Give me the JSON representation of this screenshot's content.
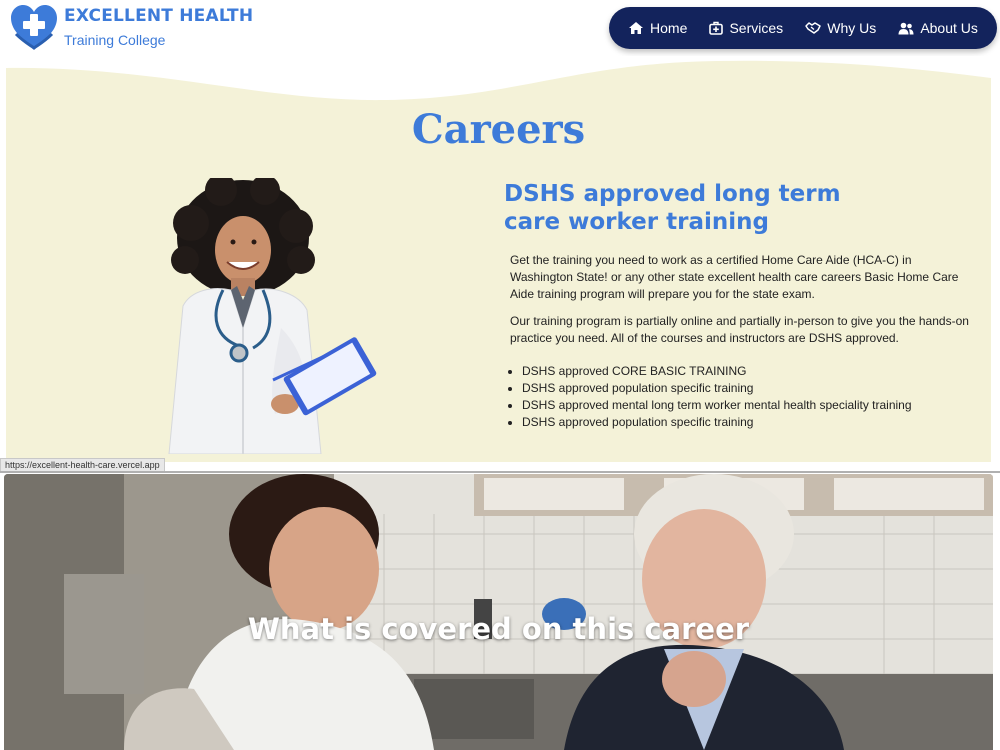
{
  "brand": {
    "title": "EXCELLENT HEALTH",
    "subtitle": "Training College"
  },
  "nav": {
    "items": [
      {
        "label": "Home",
        "icon": "home-icon"
      },
      {
        "label": "Services",
        "icon": "medical-bag-icon"
      },
      {
        "label": "Why Us",
        "icon": "handshake-icon"
      },
      {
        "label": "About Us",
        "icon": "users-icon"
      }
    ]
  },
  "careers": {
    "title": "Careers",
    "headline": "DSHS approved long term care worker training",
    "paragraphs": [
      "Get the training you need to work as a certified Home Care Aide (HCA-C) in Washington State! or any other state excellent health care careers Basic Home Care Aide training program will prepare you for the state exam.",
      "Our training program is partially online and partially in-person to give you the hands-on practice you need. All of the courses and instructors are DSHS approved."
    ],
    "bullets": [
      "DSHS approved CORE BASIC TRAINING",
      "DSHS approved population specific training",
      "DSHS approved mental long term worker mental health speciality training",
      "DSHS approved population specific training"
    ]
  },
  "status_url": "https://excellent-health-care.vercel.app",
  "hero": {
    "title": "What is covered on this career"
  },
  "colors": {
    "brand_blue": "#3d7bd9",
    "nav_bg": "#13235c",
    "section_bg": "#f4f2d8"
  }
}
